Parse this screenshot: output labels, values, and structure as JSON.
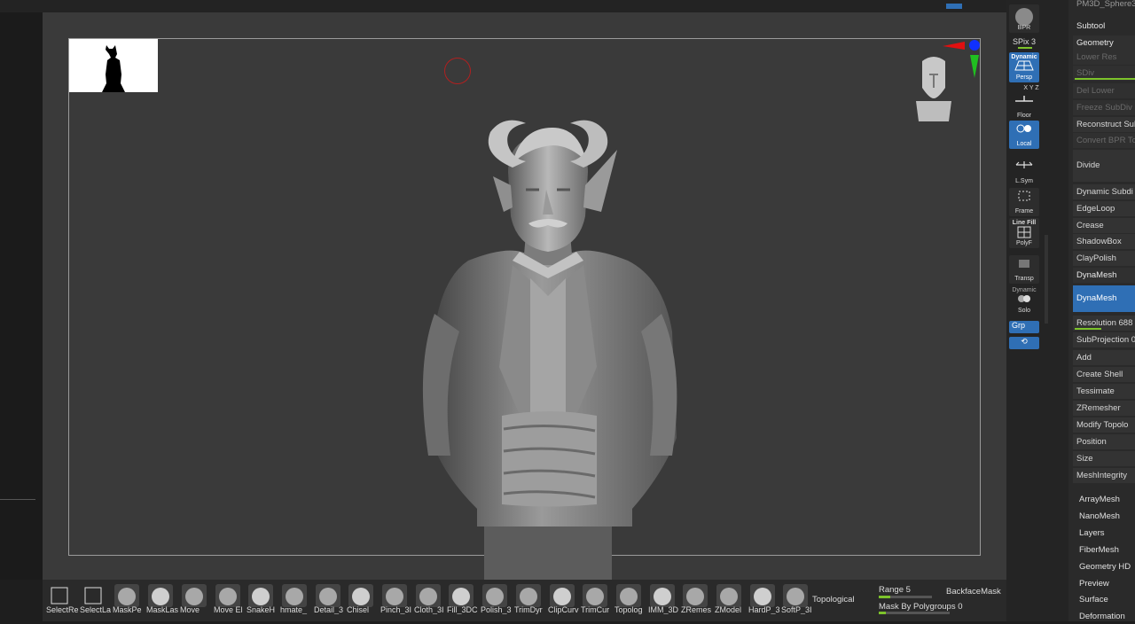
{
  "toolcol": {
    "bpr": "BPR",
    "spix": "SPix 3",
    "persp_top": "Dynamic",
    "persp": "Persp",
    "xyz": "X Y Z",
    "floor": "Floor",
    "local": "Local",
    "lsym": "L.Sym",
    "frame": "Frame",
    "linefill": "Line Fill",
    "polyf": "PolyF",
    "transp": "Transp",
    "solo_top": "Dynamic",
    "solo": "Solo",
    "grp": "Grp"
  },
  "rightpanel": {
    "title": "PM3D_Sphere3",
    "subtool": "Subtool",
    "geometry": "Geometry",
    "lower_res": "Lower Res",
    "sdiv": "SDiv",
    "del_lower": "Del Lower",
    "freeze": "Freeze SubDiv",
    "reconstruct": "Reconstruct Sub",
    "convert_bpr": "Convert BPR To",
    "divide": "Divide",
    "dynamic_subdiv": "Dynamic Subdi",
    "edgeloop": "EdgeLoop",
    "crease": "Crease",
    "shadowbox": "ShadowBox",
    "claypolish": "ClayPolish",
    "dynamesh_head": "DynaMesh",
    "dynamesh_btn": "DynaMesh",
    "resolution": "Resolution 688",
    "subprojection": "SubProjection 0",
    "add": "Add",
    "create_shell": "Create Shell",
    "tessimate": "Tessimate",
    "zremesher": "ZRemesher",
    "modify_topology": "Modify Topolo",
    "position": "Position",
    "size": "Size",
    "meshintegrity": "MeshIntegrity",
    "arraymesh": "ArrayMesh",
    "nanomesh": "NanoMesh",
    "layers": "Layers",
    "fibermesh": "FiberMesh",
    "geometry_hd": "Geometry HD",
    "preview": "Preview",
    "surface": "Surface",
    "deformation": "Deformation"
  },
  "shelf": {
    "tools": [
      {
        "label": "SelectRe",
        "icon": "select-rect-icon"
      },
      {
        "label": "SelectLa",
        "icon": "select-lasso-icon"
      },
      {
        "label": "MaskPe",
        "icon": "mask-pen-icon"
      },
      {
        "label": "MaskLas",
        "icon": "mask-lasso-icon"
      },
      {
        "label": "Move",
        "icon": "move-brush-icon"
      },
      {
        "label": "Move El",
        "icon": "move-elastic-icon"
      },
      {
        "label": "SnakeH",
        "icon": "snakehook-icon"
      },
      {
        "label": "hmate_",
        "icon": "inflate-icon"
      },
      {
        "label": "Detail_3",
        "icon": "detail-icon"
      },
      {
        "label": "Chisel",
        "icon": "chisel-icon"
      },
      {
        "label": "Pinch_3I",
        "icon": "pinch-icon"
      },
      {
        "label": "Cloth_3I",
        "icon": "cloth-icon"
      },
      {
        "label": "Fill_3DC",
        "icon": "fill-icon"
      },
      {
        "label": "Polish_3",
        "icon": "polish-icon"
      },
      {
        "label": "TrimDyr",
        "icon": "trimdyn-icon"
      },
      {
        "label": "ClipCurv",
        "icon": "clipcurve-icon"
      },
      {
        "label": "TrimCur",
        "icon": "trimcurve-icon"
      },
      {
        "label": "Topolog",
        "icon": "topology-icon"
      },
      {
        "label": "IMM_3D",
        "icon": "imm-icon"
      },
      {
        "label": "ZRemes",
        "icon": "zremesher-icon"
      },
      {
        "label": "ZModel",
        "icon": "zmodeler-icon"
      },
      {
        "label": "HardP_3",
        "icon": "hardpolish-icon"
      },
      {
        "label": "SoftP_3I",
        "icon": "softpolish-icon"
      }
    ],
    "topological": "Topological",
    "range": "Range 5",
    "range_fill": 0.22,
    "backface": "BackfaceMask",
    "mask_by_polygroups": "Mask By Polygroups 0",
    "mask_fill": 0.1
  },
  "colors": {
    "accent": "#2f6fb5",
    "slider": "#7dc32b",
    "viewport": "#3a3a3a"
  }
}
